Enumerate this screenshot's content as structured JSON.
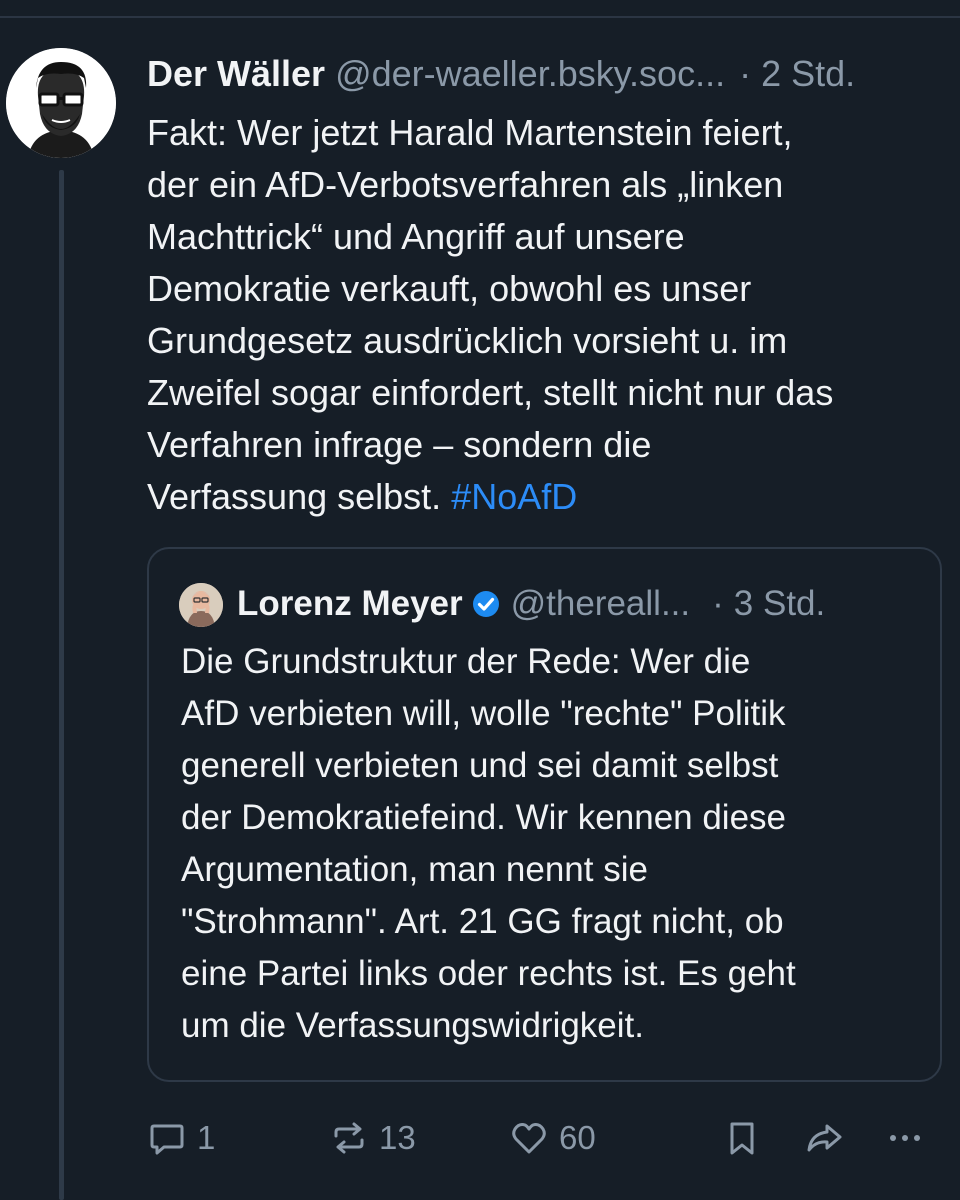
{
  "post": {
    "author_name": "Der Wäller",
    "handle": "@der-waeller.bsky.soc...",
    "separator": "·",
    "time": "2 Std.",
    "text": "Fakt: Wer jetzt Harald Martenstein feiert,\nder ein AfD-Verbotsverfahren als „linken\nMachttrick“ und Angriff auf unsere\nDemokratie verkauft, obwohl es unser\nGrundgesetz ausdrücklich vorsieht u. im\nZweifel sogar einfordert, stellt nicht nur das\nVerfahren infrage – sondern die\nVerfassung selbst.",
    "hashtag": "#NoAfD",
    "avatar_icon": "avatar-bearded-man-glasses-icon"
  },
  "quote": {
    "author_name": "Lorenz Meyer",
    "verified_icon": "verified-check-icon",
    "handle": "@thereall...",
    "separator": "·",
    "time": "3 Std.",
    "text": "Die Grundstruktur der Rede: Wer die\nAfD verbieten will, wolle \"rechte\" Politik\ngenerell verbieten und sei damit selbst\nder Demokratiefeind. Wir kennen diese\nArgumentation, man nennt sie\n\"Strohmann\". Art. 21 GG fragt nicht, ob\neine Partei links oder rechts ist. Es geht\num die Verfassungswidrigkeit."
  },
  "actions": {
    "reply_count": "1",
    "repost_count": "13",
    "like_count": "60"
  },
  "colors": {
    "background": "#161e27",
    "text": "#f1f3f5",
    "muted": "#8b99a8",
    "link": "#2c8cf7",
    "verified": "#1d8bf1",
    "border": "#2e3947"
  }
}
